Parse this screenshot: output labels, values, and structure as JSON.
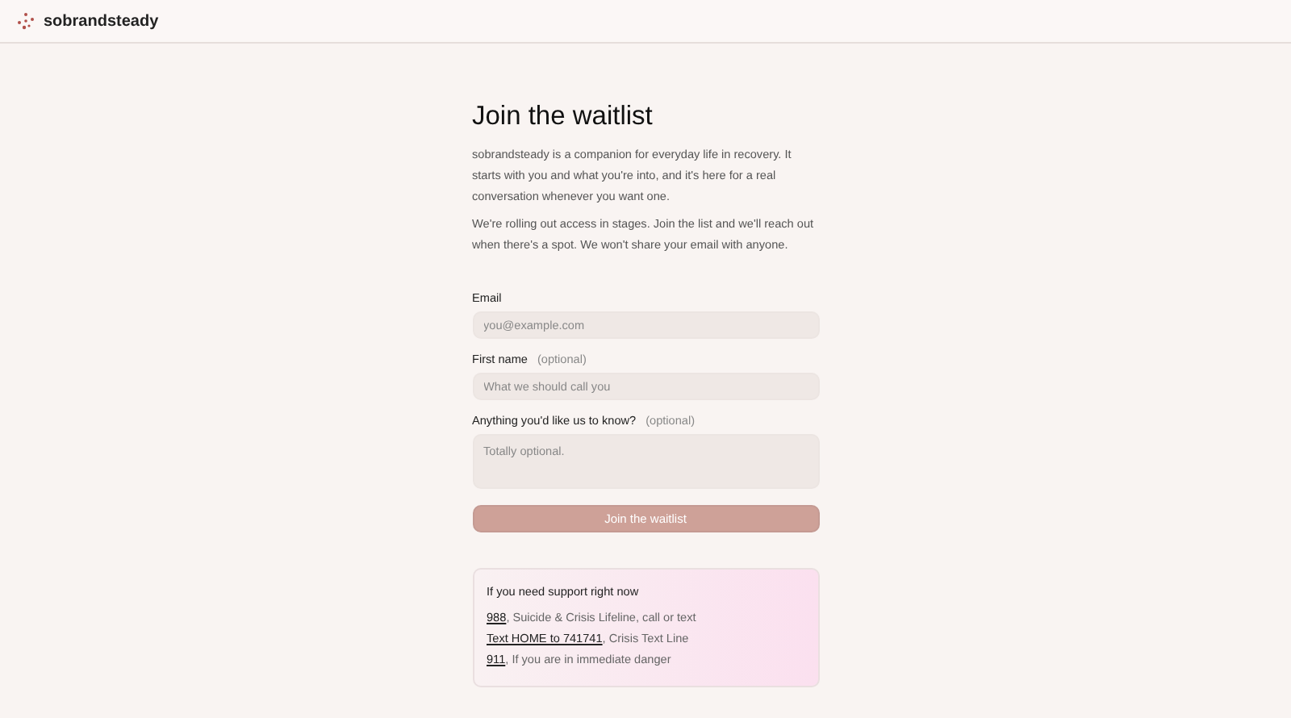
{
  "header": {
    "brand": "sobrandsteady"
  },
  "title": "Join the waitlist",
  "paragraphs": [
    "sobrandsteady is a companion for everyday life in recovery. It starts with you and what you're into, and it's here for a real conversation whenever you want one.",
    "We're rolling out access in stages. Join the list and we'll reach out when there's a spot. We won't share your email with anyone."
  ],
  "fields": [
    {
      "kind": "input",
      "label": "Email",
      "placeholder": "you@example.com"
    },
    {
      "kind": "input",
      "label": "First name",
      "note": "(optional)",
      "placeholder": "What we should call you"
    },
    {
      "kind": "textarea",
      "label": "Anything you'd like us to know?",
      "note": "(optional)",
      "placeholder": "Totally optional."
    }
  ],
  "submit": "Join the waitlist",
  "support": {
    "title": "If you need support right now",
    "lines": [
      {
        "link": "988",
        "text": ", Suicide & Crisis Lifeline, call or text"
      },
      {
        "link": "Text HOME to 741741",
        "text": ", Crisis Text Line"
      },
      {
        "link": "911",
        "text": ", If you are in immediate danger"
      }
    ]
  }
}
